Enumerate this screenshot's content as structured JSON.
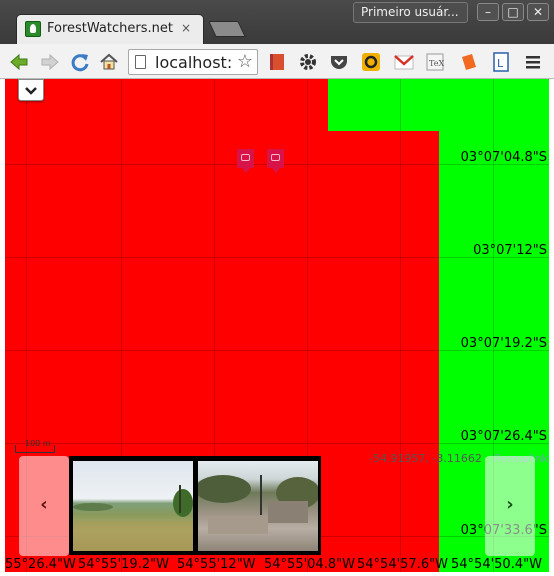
{
  "browser": {
    "tab_title": "ForestWatchers.net",
    "tab_close": "×",
    "profile_label": "Primeiro usuár...",
    "window_controls": {
      "minimize": "–",
      "maximize": "□",
      "close": "✕"
    },
    "url": "localhost:",
    "icons": [
      "back-arrow-icon",
      "forward-arrow-icon",
      "reload-icon",
      "home-icon",
      "page-icon",
      "bookmark-star-icon",
      "bookmark-red-icon",
      "gear-icon",
      "pocket-icon",
      "yellow-extension-icon",
      "gmail-icon",
      "tex-icon",
      "orange-extension-icon",
      "blue-extension-icon",
      "chrome-menu-icon"
    ]
  },
  "map": {
    "colors": {
      "deforested": "#ff0000",
      "forest": "#00ff00"
    },
    "lat_labels": [
      "03°07'04.8\"S",
      "03°07'12\"S",
      "03°07'19.2\"S",
      "03°07'26.4\"S",
      "03°07'33.6\"S"
    ],
    "lon_labels": [
      "55°26.4\"W",
      "54°55'19.2\"W",
      "54°55'12\"W",
      "54°55'04.8\"W",
      "54°54'57.6\"W",
      "54°54'50.4\"W"
    ],
    "scale_label": "100 m",
    "coordinates": "-54.91957, -3.11662",
    "permalink": "Permalink",
    "markers": [
      "camera-marker-icon",
      "camera-marker-icon"
    ]
  },
  "carousel": {
    "prev_label": "‹",
    "next_label": "›",
    "photos": [
      "field-photo",
      "stumps-photo"
    ]
  }
}
